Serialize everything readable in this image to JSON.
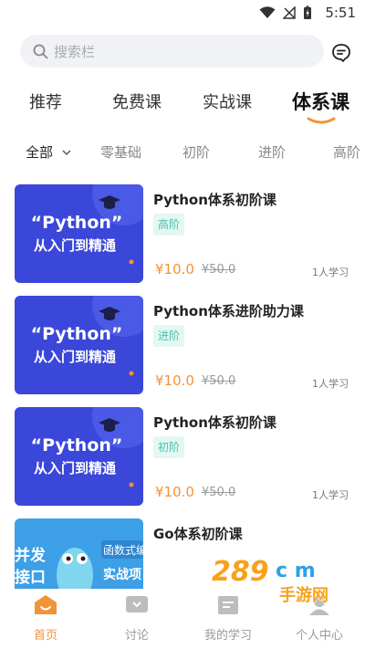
{
  "status": {
    "time": "5:51"
  },
  "search": {
    "placeholder": "搜索栏"
  },
  "tabs": [
    {
      "label": "推荐"
    },
    {
      "label": "免费课"
    },
    {
      "label": "实战课"
    },
    {
      "label": "体系课",
      "active": true
    }
  ],
  "filters": [
    {
      "label": "全部",
      "active": true
    },
    {
      "label": "零基础"
    },
    {
      "label": "初阶"
    },
    {
      "label": "进阶"
    },
    {
      "label": "高阶"
    }
  ],
  "courses": [
    {
      "title": "Python体系初阶课",
      "level": "高阶",
      "price": "¥10.0",
      "original_price": "¥50.0",
      "learners": "1人学习",
      "thumb": {
        "line1": "“Python”",
        "line2": "从入门到精通"
      }
    },
    {
      "title": "Python体系进阶助力课",
      "level": "进阶",
      "price": "¥10.0",
      "original_price": "¥50.0",
      "learners": "1人学习",
      "thumb": {
        "line1": "“Python”",
        "line2": "从入门到精通"
      }
    },
    {
      "title": "Python体系初阶课",
      "level": "初阶",
      "price": "¥10.0",
      "original_price": "¥50.0",
      "learners": "1人学习",
      "thumb": {
        "line1": "“Python”",
        "line2": "从入门到精通"
      }
    },
    {
      "title": "Go体系初阶课",
      "level": "",
      "price": "",
      "original_price": "",
      "learners": "",
      "thumb": {
        "left1": "并发",
        "left2": "接口",
        "right1": "函数式编",
        "right2": "实战项"
      }
    }
  ],
  "bottom_nav": [
    {
      "label": "首页",
      "active": true,
      "icon": "home-icon"
    },
    {
      "label": "讨论",
      "icon": "chat-icon"
    },
    {
      "label": "我的学习",
      "icon": "study-icon"
    },
    {
      "label": "个人中心",
      "icon": "user-icon"
    }
  ],
  "watermark": {
    "text1": "289",
    "text2": "c m",
    "text3": "手游网"
  },
  "colors": {
    "accent": "#f19338",
    "badge_bg": "#e3f7f3",
    "badge_text": "#4cc2a7",
    "thumb_blue": "#3847d6"
  }
}
